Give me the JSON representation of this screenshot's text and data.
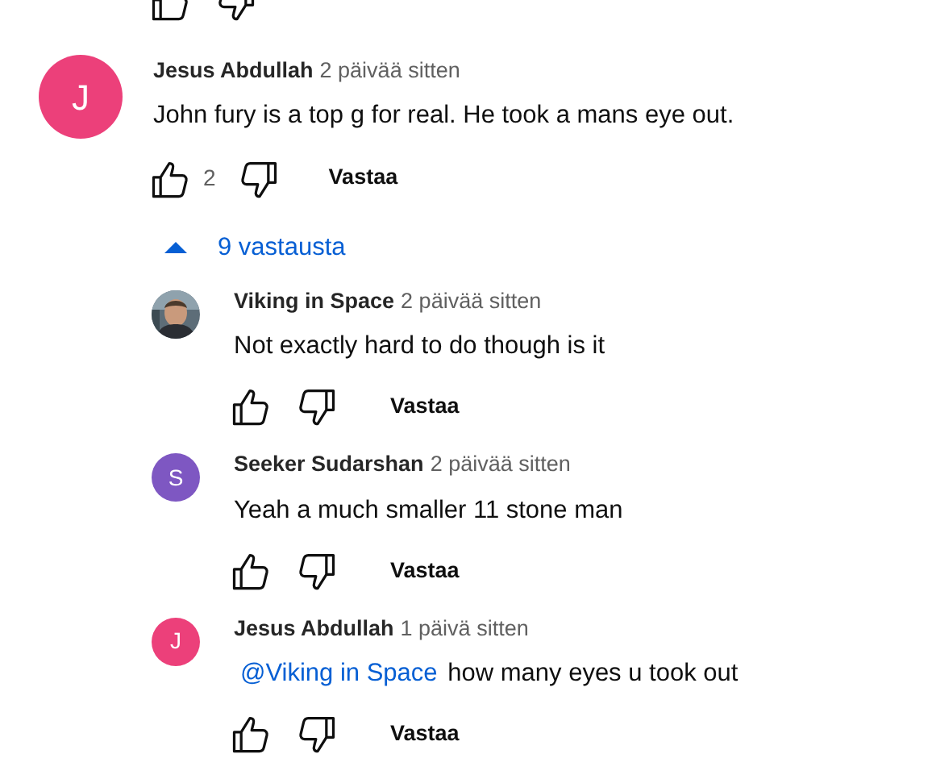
{
  "comment": {
    "avatar": {
      "letter": "J",
      "color": "#ec407a"
    },
    "author": "Jesus Abdullah",
    "time": "2 päivää sitten",
    "text": "John fury is a top g for real. He took a mans eye out.",
    "likes": "2",
    "reply": "Vastaa"
  },
  "replies_toggle": {
    "label": "9 vastausta",
    "expanded": true
  },
  "replies": [
    {
      "author": "Viking in Space",
      "time": "2 päivää sitten",
      "text": "Not exactly hard to do though is it",
      "reply": "Vastaa"
    },
    {
      "avatar": {
        "kind": "letter",
        "letter": "S",
        "color": "#7e57c2"
      },
      "author": "Seeker Sudarshan",
      "time": "2 päivää sitten",
      "text": "Yeah a much smaller 11 stone man",
      "reply": "Vastaa"
    },
    {
      "avatar": {
        "kind": "letter",
        "letter": "J",
        "color": "#ec407a"
      },
      "author": "Jesus Abdullah",
      "time": "1 päivä sitten",
      "mention": "@Viking in Space",
      "text": "how many eyes u took out",
      "reply": "Vastaa"
    }
  ]
}
